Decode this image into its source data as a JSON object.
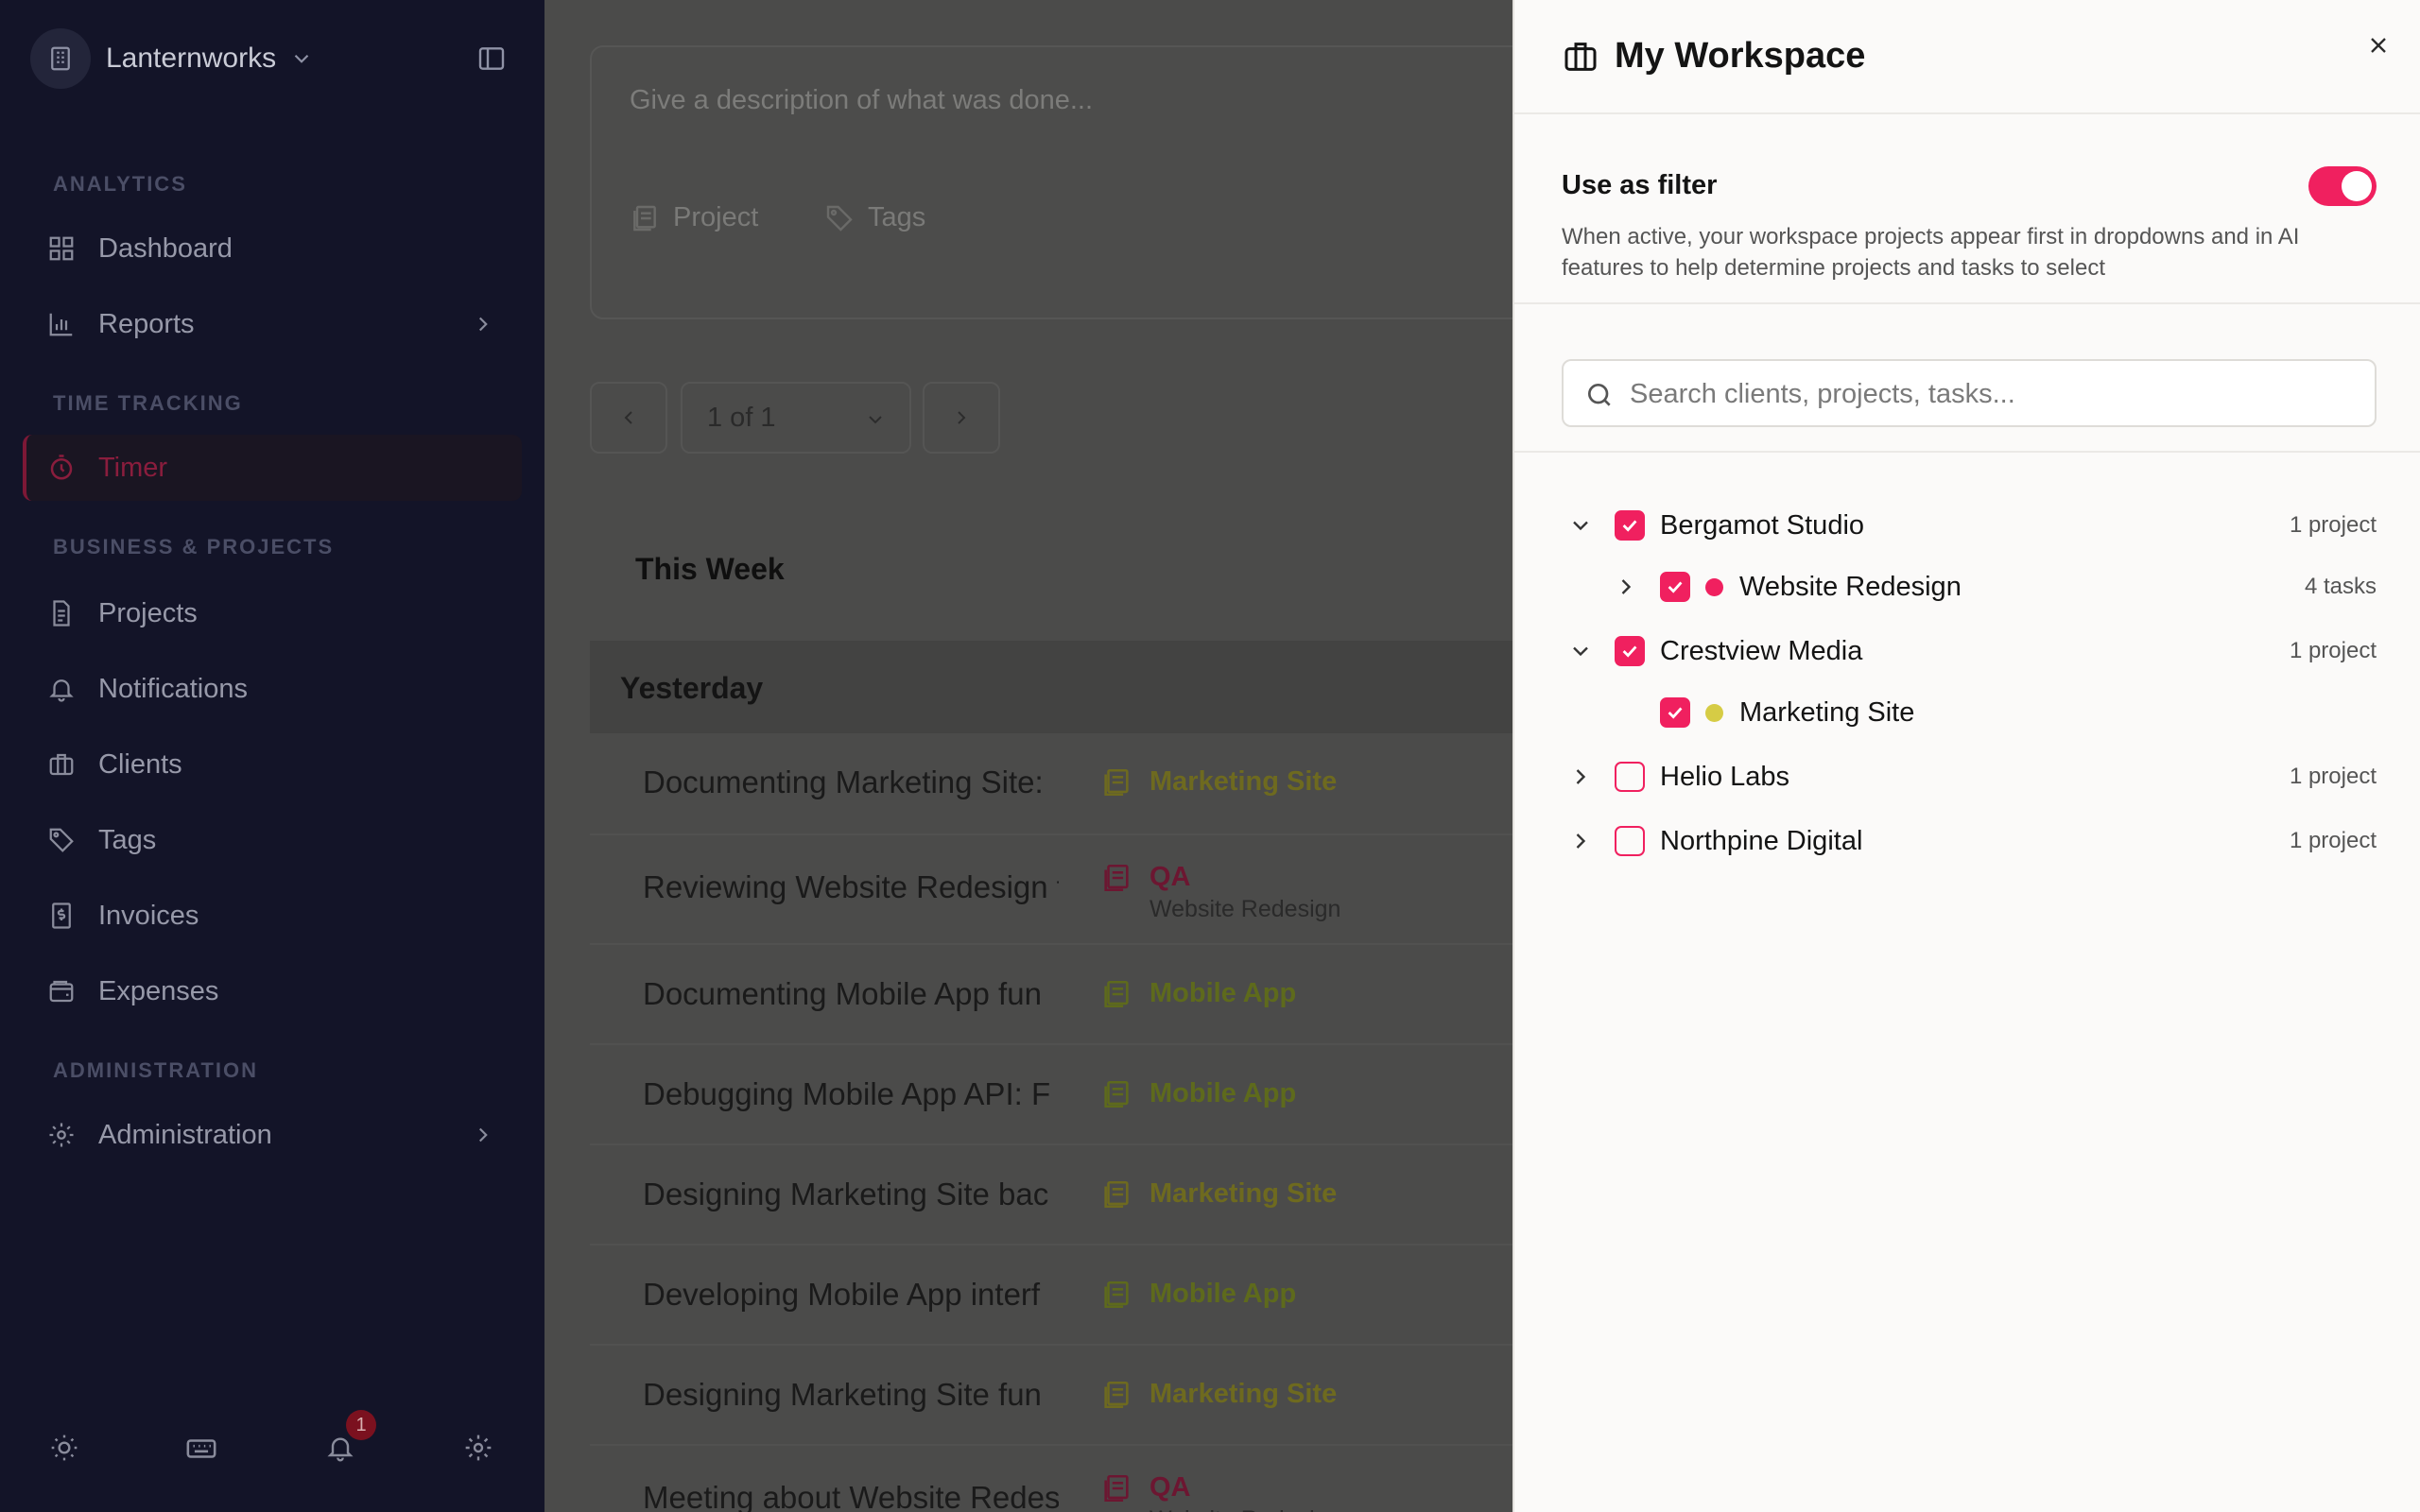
{
  "sidebar": {
    "org_name": "Lanternworks",
    "sections": {
      "analytics": "ANALYTICS",
      "time_tracking": "TIME TRACKING",
      "business": "BUSINESS & PROJECTS",
      "administration": "ADMINISTRATION"
    },
    "items": {
      "dashboard": "Dashboard",
      "reports": "Reports",
      "timer": "Timer",
      "projects": "Projects",
      "notifications": "Notifications",
      "clients": "Clients",
      "tags": "Tags",
      "invoices": "Invoices",
      "expenses": "Expenses",
      "administration": "Administration"
    },
    "notification_count": "1",
    "active_color": "#8a1d3d"
  },
  "main": {
    "description_placeholder": "Give a description of what was done...",
    "project_label": "Project",
    "tags_label": "Tags",
    "pager": "1 of 1",
    "week_title": "This Week",
    "day_title": "Yesterday",
    "entries": [
      {
        "desc": "Documenting Marketing Site:",
        "project": "Marketing Site",
        "sub": "",
        "color": "#6e6a1f"
      },
      {
        "desc": "Reviewing Website Redesign f",
        "project": "QA",
        "sub": "Website Redesign",
        "color": "#6c1631"
      },
      {
        "desc": "Documenting Mobile App fun",
        "project": "Mobile App",
        "sub": "",
        "color": "#5e6a1c"
      },
      {
        "desc": "Debugging Mobile App API: F",
        "project": "Mobile App",
        "sub": "",
        "color": "#5e6a1c"
      },
      {
        "desc": "Designing Marketing Site bac",
        "project": "Marketing Site",
        "sub": "",
        "color": "#6e6a1f"
      },
      {
        "desc": "Developing Mobile App interf",
        "project": "Mobile App",
        "sub": "",
        "color": "#5e6a1c"
      },
      {
        "desc": "Designing Marketing Site fun",
        "project": "Marketing Site",
        "sub": "",
        "color": "#6e6a1f"
      },
      {
        "desc": "Meeting about Website Redes",
        "project": "QA",
        "sub": "Website Redesign",
        "color": "#6c1631"
      }
    ]
  },
  "panel": {
    "title": "My Workspace",
    "filter_title": "Use as filter",
    "filter_desc": "When active, your workspace projects appear first in dropdowns and in AI features to help determine projects and tasks to select",
    "search_placeholder": "Search clients, projects, tasks...",
    "accent": "#f0205f",
    "tree": [
      {
        "label": "Bergamot Studio",
        "count": "1 project"
      },
      {
        "label": "Website Redesign",
        "count": "4 tasks",
        "dot": "#f0205f"
      },
      {
        "label": "Crestview Media",
        "count": "1 project"
      },
      {
        "label": "Marketing Site",
        "count": "",
        "dot": "#d6cc45"
      },
      {
        "label": "Helio Labs",
        "count": "1 project"
      },
      {
        "label": "Northpine Digital",
        "count": "1 project"
      }
    ]
  }
}
